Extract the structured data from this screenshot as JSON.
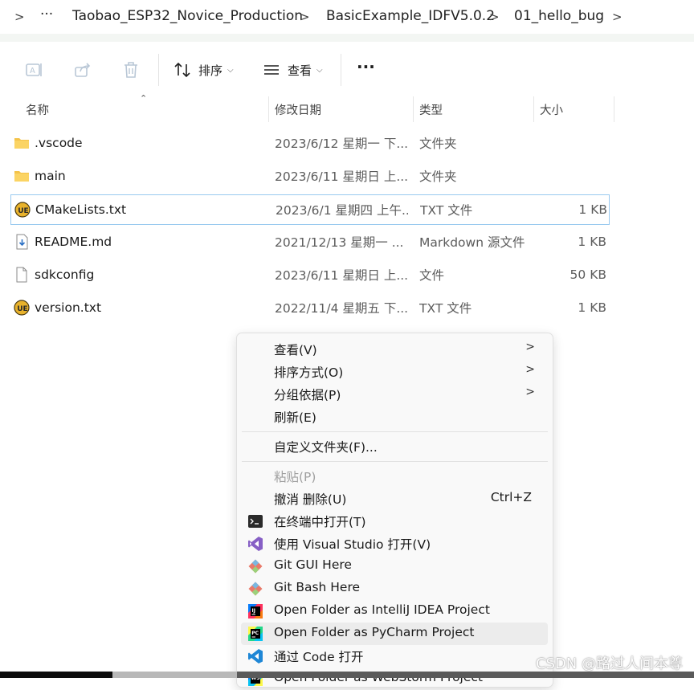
{
  "breadcrumb": {
    "overflow": "···",
    "items": [
      "Taobao_ESP32_Novice_Production",
      "BasicExample_IDFV5.0.2",
      "01_hello_bug"
    ]
  },
  "toolbar": {
    "sort_label": "排序",
    "view_label": "查看",
    "more_label": "···"
  },
  "columns": {
    "name": "名称",
    "modified": "修改日期",
    "type": "类型",
    "size": "大小"
  },
  "files": [
    {
      "icon": "folder-icon",
      "name": ".vscode",
      "modified": "2023/6/12 星期一 下...",
      "type": "文件夹",
      "size": ""
    },
    {
      "icon": "folder-icon",
      "name": "main",
      "modified": "2023/6/11 星期日 上...",
      "type": "文件夹",
      "size": ""
    },
    {
      "icon": "ultraedit-icon",
      "name": "CMakeLists.txt",
      "modified": "2023/6/1 星期四 上午...",
      "type": "TXT 文件",
      "size": "1 KB"
    },
    {
      "icon": "markdown-file-icon",
      "name": "README.md",
      "modified": "2021/12/13 星期一 ...",
      "type": "Markdown 源文件",
      "size": "1 KB"
    },
    {
      "icon": "blank-file-icon",
      "name": "sdkconfig",
      "modified": "2023/6/11 星期日 上...",
      "type": "文件",
      "size": "50 KB"
    },
    {
      "icon": "ultraedit-icon",
      "name": "version.txt",
      "modified": "2022/11/4 星期五 下...",
      "type": "TXT 文件",
      "size": "1 KB"
    }
  ],
  "context_menu": {
    "view": "查看(V)",
    "sort_by": "排序方式(O)",
    "group_by": "分组依据(P)",
    "refresh": "刷新(E)",
    "customize": "自定义文件夹(F)...",
    "paste": "粘贴(P)",
    "undo_delete": "撤消 删除(U)",
    "undo_shortcut": "Ctrl+Z",
    "open_terminal": "在终端中打开(T)",
    "open_vs": "使用 Visual Studio 打开(V)",
    "git_gui": "Git GUI Here",
    "git_bash": "Git Bash Here",
    "open_intellij": "Open Folder as IntelliJ IDEA Project",
    "open_pycharm": "Open Folder as PyCharm Project",
    "open_code": "通过 Code 打开",
    "open_webstorm": "Open Folder as WebStorm Project"
  },
  "watermark": "CSDN @路过人间本尊",
  "colors": {
    "folder": "#f4c34a",
    "selection_border": "#99c9ef",
    "menu_bg": "#f9f9f9",
    "vs_purple": "#865fc5",
    "vscode_blue": "#1f87d6",
    "git_orange": "#f05133"
  }
}
